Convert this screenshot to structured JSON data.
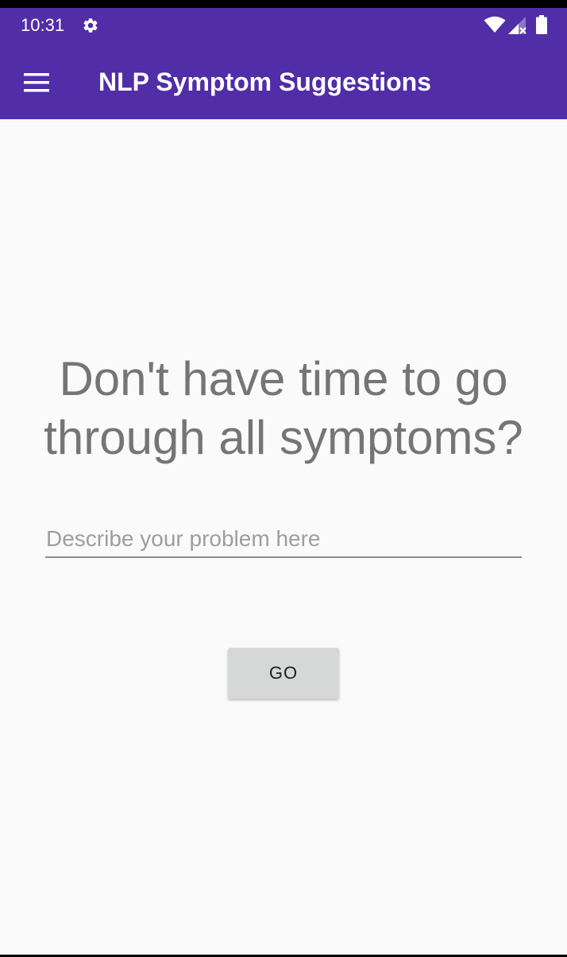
{
  "status_bar": {
    "time": "10:31",
    "icons": [
      "gear-icon",
      "wifi-icon",
      "signal-icon",
      "battery-icon"
    ],
    "background_color": "#512da8"
  },
  "app_bar": {
    "title": "NLP Symptom Suggestions",
    "menu_icon": "menu-icon",
    "background_color": "#512da8"
  },
  "main": {
    "headline": "Don't have time to go through all symptoms?",
    "problem_input": {
      "value": "",
      "placeholder": "Describe your problem here"
    },
    "go_button_label": "GO"
  }
}
